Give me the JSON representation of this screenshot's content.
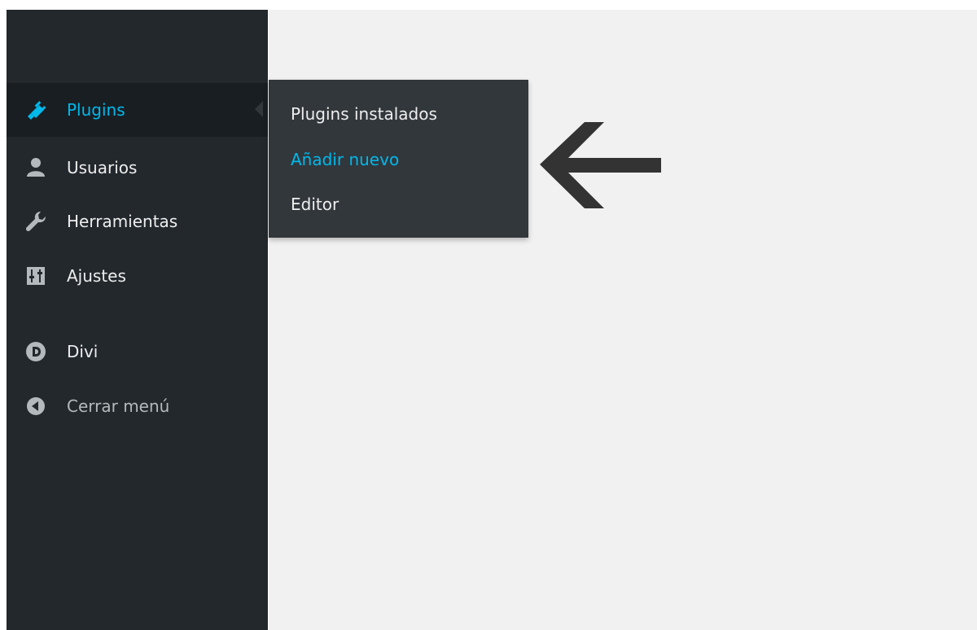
{
  "sidebar": {
    "items": [
      {
        "label": "Plugins",
        "icon": "plugin-icon",
        "active": true
      },
      {
        "label": "Usuarios",
        "icon": "user-icon"
      },
      {
        "label": "Herramientas",
        "icon": "wrench-icon"
      },
      {
        "label": "Ajustes",
        "icon": "settings-sliders-icon"
      },
      {
        "label": "Divi",
        "icon": "divi-icon"
      },
      {
        "label": "Cerrar menú",
        "icon": "collapse-icon"
      }
    ]
  },
  "submenu": {
    "items": [
      {
        "label": "Plugins instalados"
      },
      {
        "label": "Añadir nuevo",
        "current": true
      },
      {
        "label": "Editor"
      }
    ]
  },
  "colors": {
    "sidebar_bg": "#23282d",
    "submenu_bg": "#32373c",
    "accent": "#00b9eb",
    "content_bg": "#f1f1f1",
    "arrow": "#333333"
  }
}
